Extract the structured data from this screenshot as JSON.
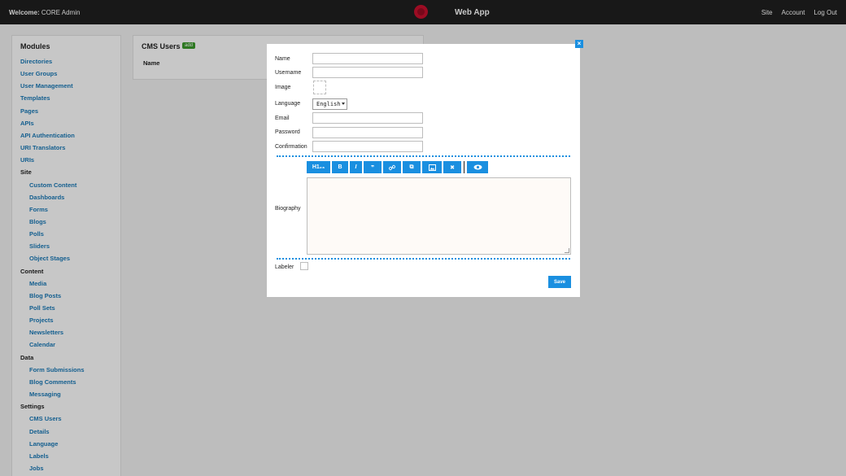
{
  "topbar": {
    "welcome_prefix": "Welcome:",
    "welcome_user": "CORE Admin",
    "app_title": "Web App",
    "links": [
      "Site",
      "Account",
      "Log Out"
    ]
  },
  "sidebar": {
    "heading": "Modules",
    "entries": [
      {
        "label": "Directories",
        "type": "item"
      },
      {
        "label": "User Groups",
        "type": "item"
      },
      {
        "label": "User Management",
        "type": "item"
      },
      {
        "label": "Templates",
        "type": "item"
      },
      {
        "label": "Pages",
        "type": "item"
      },
      {
        "label": "APIs",
        "type": "item"
      },
      {
        "label": "API Authentication",
        "type": "item"
      },
      {
        "label": "URI Translators",
        "type": "item"
      },
      {
        "label": "URIs",
        "type": "item"
      },
      {
        "label": "Site",
        "type": "section"
      },
      {
        "label": "Custom Content",
        "type": "sub"
      },
      {
        "label": "Dashboards",
        "type": "sub"
      },
      {
        "label": "Forms",
        "type": "sub"
      },
      {
        "label": "Blogs",
        "type": "sub"
      },
      {
        "label": "Polls",
        "type": "sub"
      },
      {
        "label": "Sliders",
        "type": "sub"
      },
      {
        "label": "Object Stages",
        "type": "sub"
      },
      {
        "label": "Content",
        "type": "section"
      },
      {
        "label": "Media",
        "type": "sub"
      },
      {
        "label": "Blog Posts",
        "type": "sub"
      },
      {
        "label": "Poll Sets",
        "type": "sub"
      },
      {
        "label": "Projects",
        "type": "sub"
      },
      {
        "label": "Newsletters",
        "type": "sub"
      },
      {
        "label": "Calendar",
        "type": "sub"
      },
      {
        "label": "Data",
        "type": "section"
      },
      {
        "label": "Form Submissions",
        "type": "sub"
      },
      {
        "label": "Blog Comments",
        "type": "sub"
      },
      {
        "label": "Messaging",
        "type": "sub"
      },
      {
        "label": "Settings",
        "type": "section"
      },
      {
        "label": "CMS Users",
        "type": "sub"
      },
      {
        "label": "Details",
        "type": "sub"
      },
      {
        "label": "Language",
        "type": "sub"
      },
      {
        "label": "Labels",
        "type": "sub"
      },
      {
        "label": "Jobs",
        "type": "sub"
      }
    ]
  },
  "panel": {
    "title": "CMS Users",
    "add_label": "add",
    "column_header": "Name"
  },
  "modal": {
    "close_icon": "×",
    "fields": {
      "name_label": "Name",
      "username_label": "Username",
      "image_label": "Image",
      "language_label": "Language",
      "language_value": "English",
      "email_label": "Email",
      "password_label": "Password",
      "confirmation_label": "Confirmation",
      "biography_label": "Biography",
      "labeler_label": "Labeler"
    },
    "toolbar": {
      "heading": "H1₂₃",
      "bold": "B",
      "italic": "I",
      "quote": "❞",
      "link": "🔗",
      "copy": "⧉",
      "image": "▣",
      "clear": "✖",
      "preview": "👁"
    },
    "save_label": "Save"
  },
  "colors": {
    "accent": "#1a8fe0",
    "topbar": "#1f1f1f",
    "link": "#1a7ab8",
    "add_badge": "#3a9a2b",
    "logo": "#c8102e"
  }
}
